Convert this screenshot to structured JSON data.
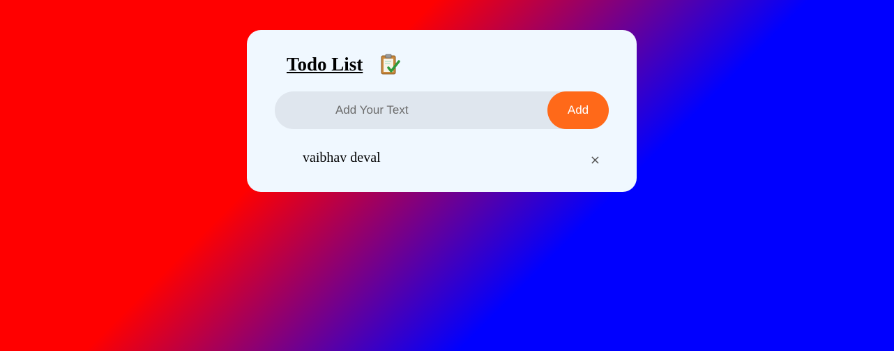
{
  "app": {
    "title": "Todo List",
    "title_icon": "clipboard-check-icon"
  },
  "input": {
    "placeholder": "Add Your Text",
    "value": ""
  },
  "add_button": {
    "label": "Add"
  },
  "todos": [
    {
      "text": "vaibhav deval",
      "remove_icon": "close-icon",
      "remove_glyph": "×"
    }
  ],
  "colors": {
    "gradient_start": "#ff0000",
    "gradient_end": "#0000ff",
    "card_background": "#f0f8ff",
    "input_background": "#dfe6ee",
    "accent": "#ff6919"
  }
}
